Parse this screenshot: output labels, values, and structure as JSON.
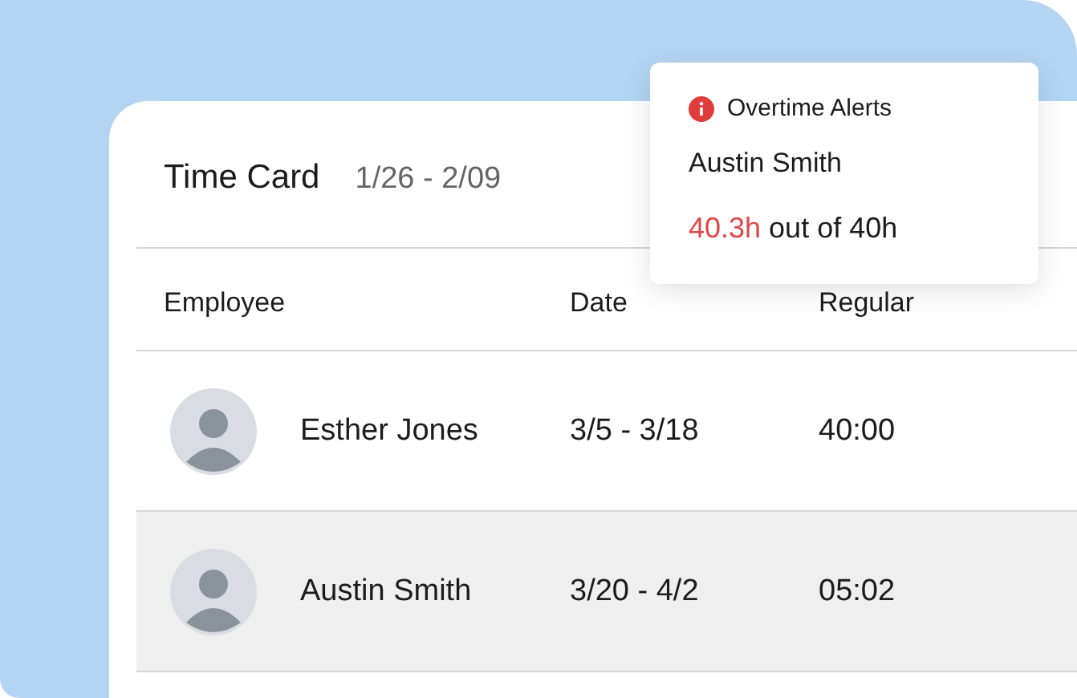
{
  "card": {
    "title": "Time Card",
    "date_range": "1/26 - 2/09"
  },
  "table": {
    "columns": [
      "Employee",
      "Date",
      "Regular"
    ],
    "rows": [
      {
        "name": "Esther Jones",
        "date": "3/5 - 3/18",
        "regular": "40:00",
        "selected": false
      },
      {
        "name": "Austin Smith",
        "date": "3/20 - 4/2",
        "regular": "05:02",
        "selected": true
      }
    ]
  },
  "alert": {
    "title": "Overtime Alerts",
    "employee": "Austin Smith",
    "hours": "40.3h",
    "limit": "out of 40h"
  }
}
